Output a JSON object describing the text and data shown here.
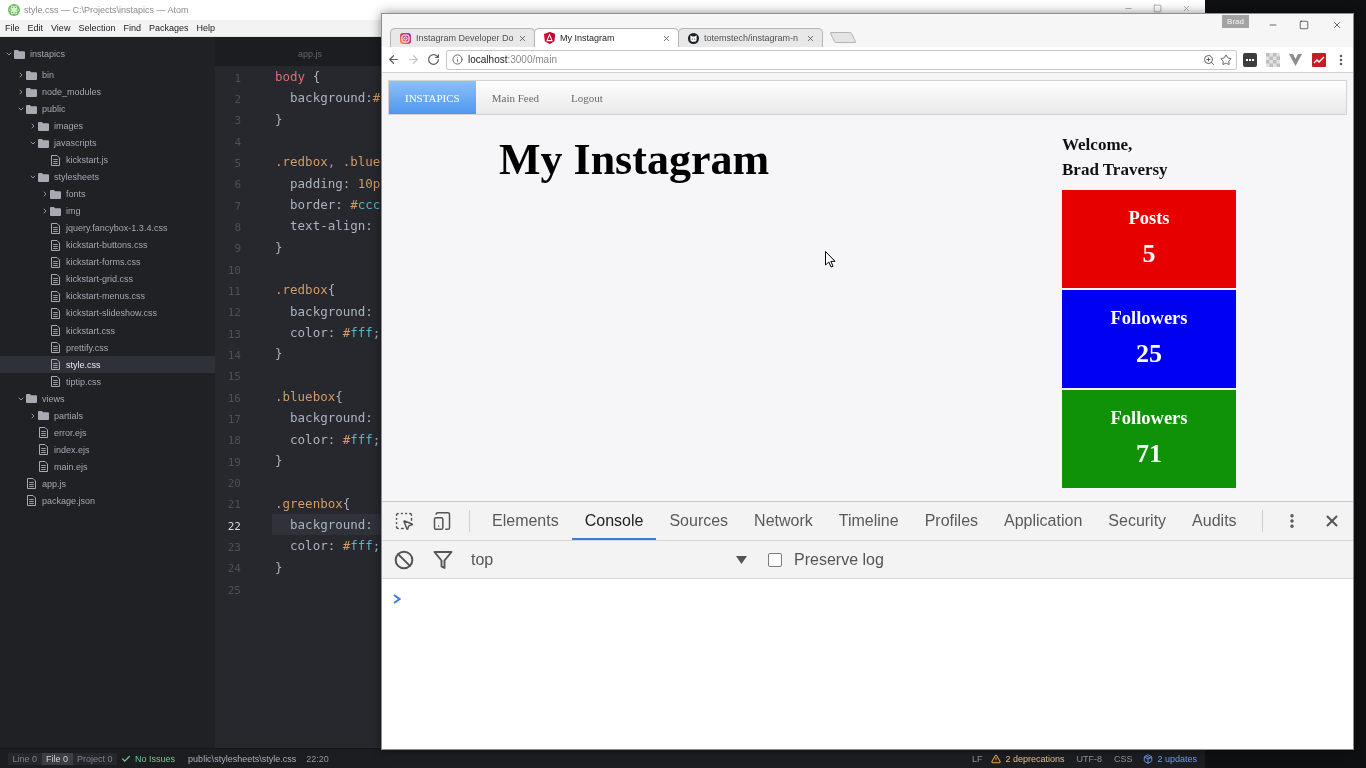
{
  "atom": {
    "title": "style.css — C:\\Projects\\instapics — Atom",
    "menu": [
      "File",
      "Edit",
      "View",
      "Selection",
      "Find",
      "Packages",
      "Help"
    ],
    "tree": {
      "name": "instapics",
      "kind": "folder",
      "expanded": true,
      "selected": false,
      "children": [
        {
          "name": "bin",
          "kind": "folder",
          "expanded": false,
          "selected": false
        },
        {
          "name": "node_modules",
          "kind": "folder",
          "expanded": false,
          "selected": false
        },
        {
          "name": "public",
          "kind": "folder",
          "expanded": true,
          "selected": false,
          "children": [
            {
              "name": "images",
              "kind": "folder",
              "expanded": false,
              "selected": false
            },
            {
              "name": "javascripts",
              "kind": "folder",
              "expanded": true,
              "selected": false,
              "children": [
                {
                  "name": "kickstart.js",
                  "kind": "file",
                  "selected": false
                }
              ]
            },
            {
              "name": "stylesheets",
              "kind": "folder",
              "expanded": true,
              "selected": false,
              "children": [
                {
                  "name": "fonts",
                  "kind": "folder",
                  "expanded": false,
                  "selected": false
                },
                {
                  "name": "img",
                  "kind": "folder",
                  "expanded": false,
                  "selected": false
                },
                {
                  "name": "jquery.fancybox-1.3.4.css",
                  "kind": "file",
                  "selected": false
                },
                {
                  "name": "kickstart-buttons.css",
                  "kind": "file",
                  "selected": false
                },
                {
                  "name": "kickstart-forms.css",
                  "kind": "file",
                  "selected": false
                },
                {
                  "name": "kickstart-grid.css",
                  "kind": "file",
                  "selected": false
                },
                {
                  "name": "kickstart-menus.css",
                  "kind": "file",
                  "selected": false
                },
                {
                  "name": "kickstart-slideshow.css",
                  "kind": "file",
                  "selected": false
                },
                {
                  "name": "kickstart.css",
                  "kind": "file",
                  "selected": false
                },
                {
                  "name": "prettify.css",
                  "kind": "file",
                  "selected": false
                },
                {
                  "name": "style.css",
                  "kind": "file",
                  "selected": true
                },
                {
                  "name": "tiptip.css",
                  "kind": "file",
                  "selected": false
                }
              ]
            }
          ]
        },
        {
          "name": "views",
          "kind": "folder",
          "expanded": true,
          "selected": false,
          "children": [
            {
              "name": "partials",
              "kind": "folder",
              "expanded": false,
              "selected": false
            },
            {
              "name": "error.ejs",
              "kind": "file",
              "selected": false
            },
            {
              "name": "index.ejs",
              "kind": "file",
              "selected": false
            },
            {
              "name": "main.ejs",
              "kind": "file",
              "selected": false
            }
          ]
        },
        {
          "name": "app.js",
          "kind": "file",
          "selected": false
        },
        {
          "name": "package.json",
          "kind": "file",
          "selected": false
        }
      ]
    },
    "editor_tabs": [
      {
        "label": "app.js",
        "selected": false
      }
    ],
    "lines": [
      {
        "number": "1",
        "current": false,
        "tokens": [
          {
            "kind": "tag",
            "text": "body"
          },
          {
            "kind": "text",
            "text": " {"
          }
        ]
      },
      {
        "number": "2",
        "current": false,
        "tokens": [
          {
            "kind": "text",
            "text": "  background:"
          },
          {
            "kind": "number",
            "text": "#"
          }
        ]
      },
      {
        "number": "3",
        "current": false,
        "tokens": [
          {
            "kind": "text",
            "text": "}"
          }
        ]
      },
      {
        "number": "4",
        "current": false
      },
      {
        "number": "5",
        "current": false,
        "tokens": [
          {
            "kind": "class",
            "text": ".redbox"
          },
          {
            "kind": "comma",
            "text": ","
          },
          {
            "kind": "class",
            "text": " .blue"
          }
        ]
      },
      {
        "number": "6",
        "current": false,
        "tokens": [
          {
            "kind": "text",
            "text": "  padding: "
          },
          {
            "kind": "number",
            "text": "10p"
          }
        ]
      },
      {
        "number": "7",
        "current": false,
        "tokens": [
          {
            "kind": "text",
            "text": "  border: "
          },
          {
            "kind": "number",
            "text": "#"
          },
          {
            "kind": "hex",
            "text": "ccc"
          }
        ]
      },
      {
        "number": "8",
        "current": false,
        "tokens": [
          {
            "kind": "text",
            "text": "  text-align:"
          }
        ]
      },
      {
        "number": "9",
        "current": false,
        "tokens": [
          {
            "kind": "text",
            "text": "}"
          }
        ]
      },
      {
        "number": "10",
        "current": false
      },
      {
        "number": "11",
        "current": false,
        "tokens": [
          {
            "kind": "class",
            "text": ".redbox"
          },
          {
            "kind": "text",
            "text": "{"
          }
        ]
      },
      {
        "number": "12",
        "current": false,
        "tokens": [
          {
            "kind": "text",
            "text": "  background:"
          }
        ]
      },
      {
        "number": "13",
        "current": false,
        "tokens": [
          {
            "kind": "text",
            "text": "  color: "
          },
          {
            "kind": "number",
            "text": "#"
          },
          {
            "kind": "hex",
            "text": "fff"
          },
          {
            "kind": "text",
            "text": ";"
          }
        ]
      },
      {
        "number": "14",
        "current": false,
        "tokens": [
          {
            "kind": "text",
            "text": "}"
          }
        ]
      },
      {
        "number": "15",
        "current": false
      },
      {
        "number": "16",
        "current": false,
        "tokens": [
          {
            "kind": "class",
            "text": ".bluebox"
          },
          {
            "kind": "text",
            "text": "{"
          }
        ]
      },
      {
        "number": "17",
        "current": false,
        "tokens": [
          {
            "kind": "text",
            "text": "  background:"
          }
        ]
      },
      {
        "number": "18",
        "current": false,
        "tokens": [
          {
            "kind": "text",
            "text": "  color: "
          },
          {
            "kind": "number",
            "text": "#"
          },
          {
            "kind": "hex",
            "text": "fff"
          },
          {
            "kind": "text",
            "text": ";"
          }
        ]
      },
      {
        "number": "19",
        "current": false,
        "tokens": [
          {
            "kind": "text",
            "text": "}"
          }
        ]
      },
      {
        "number": "20",
        "current": false
      },
      {
        "number": "21",
        "current": false,
        "tokens": [
          {
            "kind": "class",
            "text": ".greenbox"
          },
          {
            "kind": "text",
            "text": "{"
          }
        ]
      },
      {
        "number": "22",
        "current": true,
        "tokens": [
          {
            "kind": "text",
            "text": "  background:"
          }
        ]
      },
      {
        "number": "23",
        "current": false,
        "tokens": [
          {
            "kind": "text",
            "text": "  color: "
          },
          {
            "kind": "number",
            "text": "#"
          },
          {
            "kind": "hex",
            "text": "fff"
          },
          {
            "kind": "text",
            "text": ";"
          }
        ]
      },
      {
        "number": "24",
        "current": false,
        "tokens": [
          {
            "kind": "text",
            "text": "}"
          }
        ]
      },
      {
        "number": "25",
        "current": false
      }
    ],
    "status_bar": {
      "linter_tabs": [
        {
          "label": "Line 0",
          "selected": false
        },
        {
          "label": "File 0",
          "selected": true
        },
        {
          "label": "Project 0",
          "selected": false
        }
      ],
      "issues": "No Issues",
      "path": "public\\stylesheets\\style.css",
      "cursor": "22:20",
      "line_ending": "LF",
      "deprecations": "2 deprecations",
      "encoding": "UTF-8",
      "grammar": "CSS",
      "updates": "2 updates"
    }
  },
  "browser": {
    "tabs": [
      {
        "title": "Instagram Developer Do",
        "kind": "camera",
        "selected": false
      },
      {
        "title": "My Instagram",
        "kind": "shield",
        "selected": true
      },
      {
        "title": "totemstech/instagram-n",
        "kind": "cat",
        "selected": false
      }
    ],
    "profile": "Brad",
    "nav_buttons": [
      {
        "kind": "back",
        "disabled": false
      },
      {
        "kind": "forward",
        "disabled": true
      },
      {
        "kind": "reload",
        "disabled": false
      }
    ],
    "address": {
      "host": "localhost",
      "path": ":3000/main"
    },
    "extensions": [
      {
        "kind": "dots"
      },
      {
        "kind": "checker"
      },
      {
        "kind": "v"
      },
      {
        "kind": "chart"
      }
    ],
    "page": {
      "nav": [
        {
          "label": "INSTAPICS",
          "selected": true
        },
        {
          "label": "Main Feed",
          "selected": false
        },
        {
          "label": "Logout",
          "selected": false
        }
      ],
      "heading": "My Instagram",
      "welcome": "Welcome,",
      "user": "Brad Traversy",
      "stats": [
        {
          "label": "Posts",
          "value": "5",
          "color": "#e70000"
        },
        {
          "label": "Followers",
          "value": "25",
          "color": "#0000f2"
        },
        {
          "label": "Followers",
          "value": "71",
          "color": "#0f9208"
        }
      ]
    },
    "devtools": {
      "tabs": [
        {
          "label": "Elements",
          "selected": false
        },
        {
          "label": "Console",
          "selected": true
        },
        {
          "label": "Sources",
          "selected": false
        },
        {
          "label": "Network",
          "selected": false
        },
        {
          "label": "Timeline",
          "selected": false
        },
        {
          "label": "Profiles",
          "selected": false
        },
        {
          "label": "Application",
          "selected": false
        },
        {
          "label": "Security",
          "selected": false
        },
        {
          "label": "Audits",
          "selected": false
        }
      ],
      "context": "top",
      "preserve_log": {
        "label": "Preserve log",
        "checked": false
      }
    }
  }
}
